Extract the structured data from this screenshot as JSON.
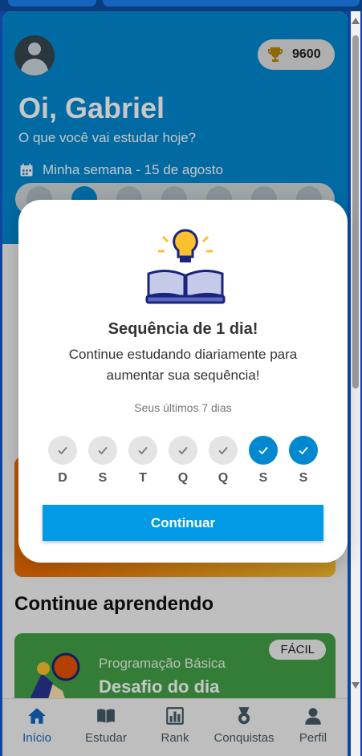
{
  "header": {
    "points": "9600",
    "greeting": "Oi, Gabriel",
    "subtitle": "O que você vai estudar hoje?",
    "week_label": "Minha semana - 15 de agosto"
  },
  "section": {
    "continue_title": "Continue aprendendo"
  },
  "course_card": {
    "badge": "FÁCIL",
    "category": "Programação Básica",
    "title": "Desafio do dia"
  },
  "nav": [
    {
      "label": "Início",
      "icon": "home-icon",
      "active": true
    },
    {
      "label": "Estudar",
      "icon": "book-icon",
      "active": false
    },
    {
      "label": "Rank",
      "icon": "bar-chart-icon",
      "active": false
    },
    {
      "label": "Conquistas",
      "icon": "medal-icon",
      "active": false
    },
    {
      "label": "Perfil",
      "icon": "person-icon",
      "active": false
    }
  ],
  "modal": {
    "icon": "lightbulb-book-icon",
    "title": "Sequência de 1 dia!",
    "message": "Continue estudando diariamente para aumentar sua sequência!",
    "caption": "Seus últimos 7 dias",
    "days": [
      {
        "label": "D",
        "done": false
      },
      {
        "label": "S",
        "done": false
      },
      {
        "label": "T",
        "done": false
      },
      {
        "label": "Q",
        "done": false
      },
      {
        "label": "Q",
        "done": false
      },
      {
        "label": "S",
        "done": true
      },
      {
        "label": "S",
        "done": true
      }
    ],
    "button": "Continuar"
  },
  "colors": {
    "primary": "#0288d1",
    "button": "#039be5",
    "nav_active": "#1565c0",
    "card_green": "#43a047"
  }
}
